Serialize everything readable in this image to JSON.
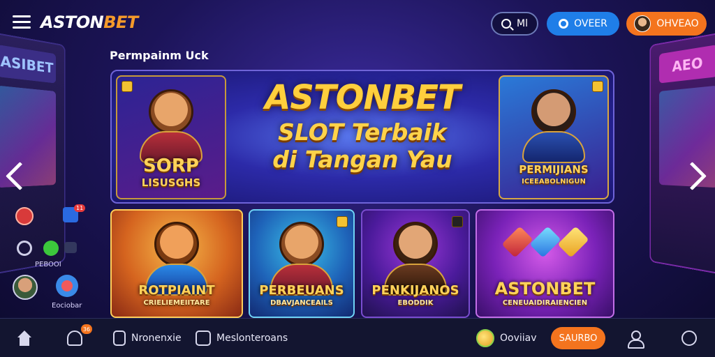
{
  "header": {
    "logo_part1": "ASTON",
    "logo_part2": "BET",
    "search_label": "Ml",
    "daftar_label": "OVEER",
    "masuk_label": "OHVEAO"
  },
  "section": {
    "title": "Permpainm Uck"
  },
  "hero": {
    "line1": "ASTONBET",
    "line2": "SLOT Terbaik",
    "line3": "di Tangan Yau",
    "left_card": {
      "title": "SORP",
      "subtitle": "LISUSGHS"
    },
    "right_card": {
      "title": "PERMIJIANS",
      "subtitle": "ICEEABOLNIGUN"
    }
  },
  "arcade": {
    "left_marquee": "ASIBET",
    "right_marquee": "AEO"
  },
  "games": [
    {
      "title": "ROTPIAINT",
      "subtitle": "CRIELIEMEIITARE",
      "icon": "fox-icon"
    },
    {
      "title": "PERBEUANS",
      "subtitle": "DBAVJANCEAILS",
      "icon": "warrior-icon"
    },
    {
      "title": "PENKIJANOS",
      "subtitle": "EBODDIK",
      "icon": "cowboy-icon"
    },
    {
      "title": "ASTONBET",
      "subtitle": "CENEUAIDIRAIENCIEN",
      "icon": "gems-icon"
    }
  ],
  "side": {
    "badge_count": "11",
    "label1": "PEBOOI",
    "label2": "Eociobar"
  },
  "bottom_nav": {
    "promo_badge": "36",
    "item1_label": "Nronenxie",
    "item2_label": "Meslonteroans",
    "coin_label": "Ooviiav",
    "cta_label": "SAURBO"
  },
  "colors": {
    "accent_orange": "#f4741e",
    "accent_blue": "#1f7ee8",
    "gold": "#ffcf3d",
    "nav_bg": "#131530"
  }
}
